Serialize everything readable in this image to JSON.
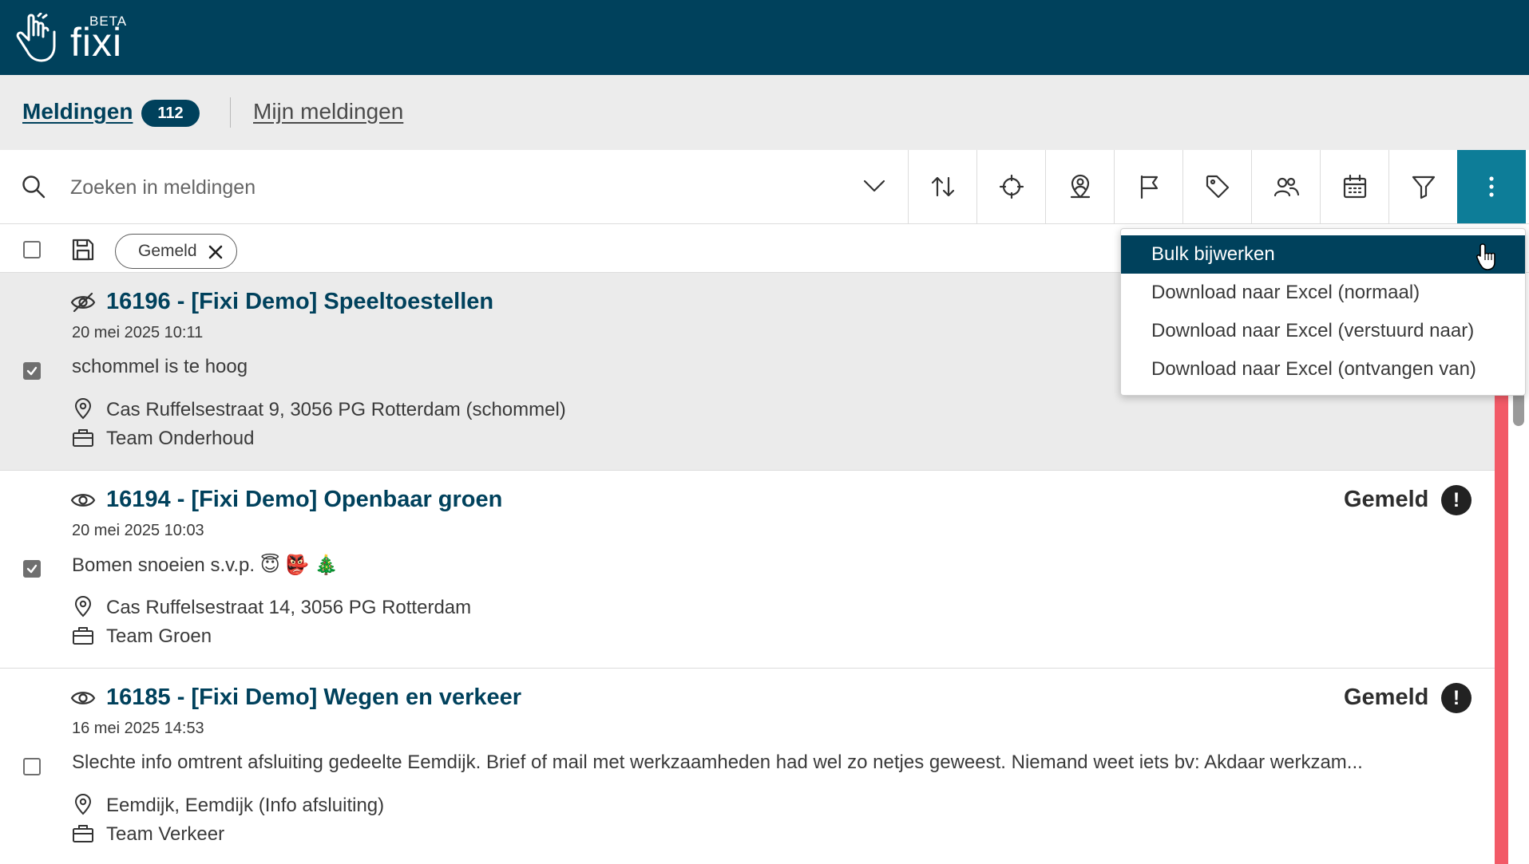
{
  "app": {
    "logo_text": "fixi",
    "logo_badge": "BETA"
  },
  "tabs": {
    "active_label": "Meldingen",
    "active_count": "112",
    "other_label": "Mijn meldingen"
  },
  "search": {
    "placeholder": "Zoeken in meldingen",
    "value": ""
  },
  "toolbar": {
    "buttons": [
      "sort-icon",
      "crosshair-icon",
      "location-person-icon",
      "flag-icon",
      "tag-icon",
      "users-icon",
      "calendar-icon",
      "filter-icon",
      "more-vertical-icon"
    ]
  },
  "filters": {
    "chip_label": "Gemeld"
  },
  "menu": {
    "items": [
      "Bulk bijwerken",
      "Download naar Excel (normaal)",
      "Download naar Excel (verstuurd naar)",
      "Download naar Excel (ontvangen van)"
    ],
    "highlighted": "Bulk bijwerken"
  },
  "items": [
    {
      "title": "16196 - [Fixi Demo] Speeltoestellen",
      "date": "20 mei 2025 10:11",
      "description": "schommel is te hoog",
      "location": "Cas Ruffelsestraat 9, 3056 PG Rotterdam (schommel)",
      "team": "Team Onderhoud",
      "status": "",
      "checked": true,
      "seen": false
    },
    {
      "title": "16194 - [Fixi Demo] Openbaar groen",
      "date": "20 mei 2025 10:03",
      "description": "Bomen snoeien s.v.p. 😇 👺 🎄",
      "location": "Cas Ruffelsestraat 14, 3056 PG Rotterdam",
      "team": "Team Groen",
      "status": "Gemeld",
      "priority_symbol": "!",
      "checked": true,
      "seen": true
    },
    {
      "title": "16185 - [Fixi Demo] Wegen en verkeer",
      "date": "16 mei 2025 14:53",
      "description": "Slechte info omtrent afsluiting gedeelte Eemdijk. Brief of mail met werkzaamheden had wel zo netjes geweest. Niemand weet iets bv: Akdaar werkzam...",
      "location": "Eemdijk, Eemdijk (Info afsluiting)",
      "team": "Team Verkeer",
      "status": "Gemeld",
      "priority_symbol": "!",
      "checked": false,
      "seen": true
    }
  ],
  "colors": {
    "brand": "#00415c",
    "accent_active": "#0d7d98",
    "priority_bar": "#f25a67"
  }
}
